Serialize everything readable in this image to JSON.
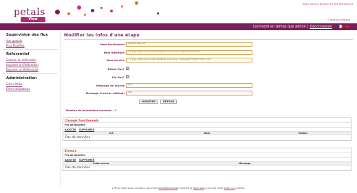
{
  "header": {
    "logo_text": "petals",
    "logo_sub": "View",
    "tagline": "Open Source Business Flow Monitoring",
    "creative": "Creative edition",
    "status_text": "Connecté en temps que admin",
    "logout_label": "Déconnexion"
  },
  "sidebar": {
    "sections": [
      {
        "title": "Supervision des flux",
        "links": [
          "Vue globale",
          "Flux FlowTest"
        ]
      },
      {
        "title": "Référentiel",
        "links": [
          "Gestion du référentiel",
          "Importer un Référentiel",
          "Exporter un Référentiel"
        ]
      },
      {
        "title": "Administration",
        "links": [
          "Gérer Rôles",
          "Gérer utilisateurs"
        ]
      }
    ]
  },
  "form": {
    "title": "Modifier les infos d'une étape",
    "fields": [
      {
        "label": "Nom fonctionnel",
        "value": "State Name"
      },
      {
        "label": "Nom interface",
        "value": "{http://petals2008.ebasecnas.eu}FootballPoolEP"
      },
      {
        "label": "Nom service",
        "value": "{http://petals2008.ebasecnas.eu}FootballPoolEPService"
      },
      {
        "label": "Début flux?",
        "value": "☑"
      },
      {
        "label": "Fin flux?",
        "value": "☐"
      },
      {
        "label": "Message de succès",
        "value": "OK"
      },
      {
        "label": "Message d'erreur (défaut)",
        "value": "KO"
      }
    ],
    "modify_button": "MODIFIER",
    "back_button": "RETOUR",
    "nb_params_label": "Nombre de paramètres insoumis :",
    "nb_params_value": "1"
  },
  "functional_fields": {
    "title": "Champs fonctionnels",
    "subtitle": "Pas de données",
    "actions": [
      "AJOUTER",
      "SUPPRIMER"
    ],
    "columns": [
      "Clé",
      "Nom",
      "Global"
    ],
    "empty": "Pas de données"
  },
  "errors": {
    "title": "Erreurs",
    "subtitle": "Pas de données",
    "actions": [
      "AJOUTER",
      "SUPPRIMER"
    ],
    "columns": [
      "Code erreur",
      "Message"
    ],
    "empty": "Pas de données"
  },
  "footer": {
    "text_1": "▸ Petals Supervision Console ▸ Copyrights",
    "link_1": "ebmwebsourcing",
    "text_2": "▸ Powered by",
    "link_2": "Open Suit",
    "text_3": "▸ Licenced under",
    "link_3": "LGPL v2.1",
    "text_4": "▸ 2008 ▸"
  }
}
